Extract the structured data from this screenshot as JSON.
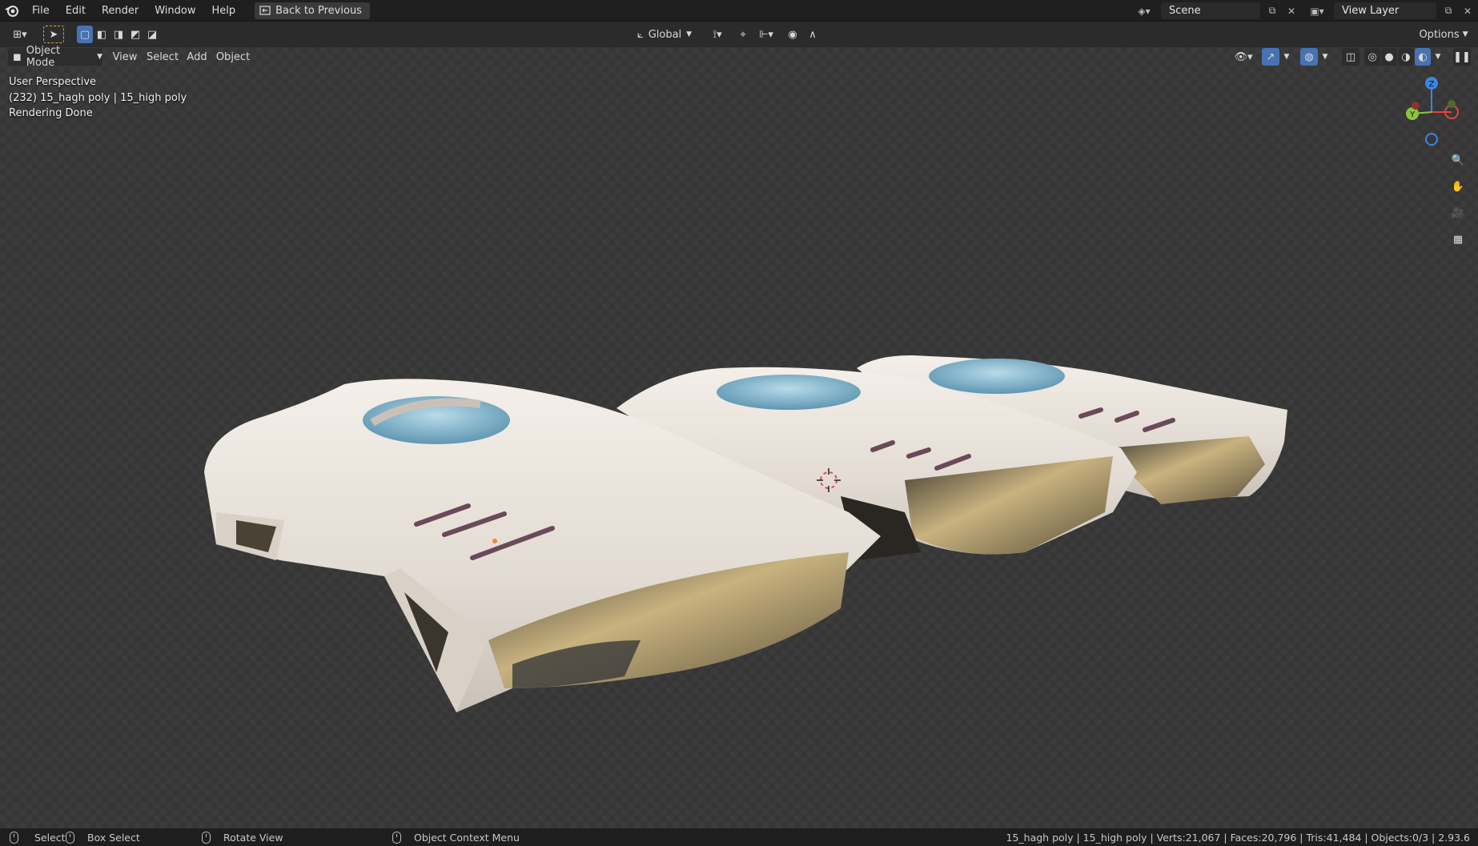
{
  "menubar": {
    "items": [
      "File",
      "Edit",
      "Render",
      "Window",
      "Help"
    ],
    "back_button": "Back to Previous",
    "scene_name": "Scene",
    "view_layer": "View Layer"
  },
  "toolheader": {
    "transform_orientation": "Global",
    "options_label": "Options"
  },
  "viewheader": {
    "mode": "Object Mode",
    "menus": [
      "View",
      "Select",
      "Add",
      "Object"
    ]
  },
  "overlay": {
    "line1": "User Perspective",
    "line2": "(232) 15_hagh poly | 15_high poly",
    "line3": "Rendering Done"
  },
  "gizmo": {
    "z_label": "Z",
    "y_label": "Y",
    "colors": {
      "x": "#e24343",
      "y": "#8cc63f",
      "z": "#3d85e0"
    }
  },
  "statusbar": {
    "select": "Select",
    "box_select": "Box Select",
    "rotate_view": "Rotate View",
    "context_menu": "Object Context Menu",
    "stats": "15_hagh poly | 15_high poly | Verts:21,067 | Faces:20,796 | Tris:41,484 | Objects:0/3 | 2.93.6"
  },
  "colors": {
    "accent": "#4772b3",
    "model_body": "#e6e0d8",
    "model_glass": "#7fb4cf",
    "model_metal": "#b09a6a"
  }
}
